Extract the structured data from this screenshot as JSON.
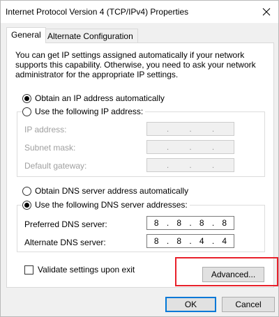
{
  "window": {
    "title": "Internet Protocol Version 4 (TCP/IPv4) Properties"
  },
  "tabs": [
    {
      "label": "General",
      "active": true
    },
    {
      "label": "Alternate Configuration",
      "active": false
    }
  ],
  "general": {
    "intro": "You can get IP settings assigned automatically if your network supports this capability. Otherwise, you need to ask your network administrator for the appropriate IP settings.",
    "ip_auto_label": "Obtain an IP address automatically",
    "ip_manual_label": "Use the following IP address:",
    "ip_fields": [
      {
        "label": "IP address:",
        "octets": [
          "",
          "",
          "",
          ""
        ]
      },
      {
        "label": "Subnet mask:",
        "octets": [
          "",
          "",
          "",
          ""
        ]
      },
      {
        "label": "Default gateway:",
        "octets": [
          "",
          "",
          "",
          ""
        ]
      }
    ],
    "dns_auto_label": "Obtain DNS server address automatically",
    "dns_manual_label": "Use the following DNS server addresses:",
    "dns_fields": [
      {
        "label": "Preferred DNS server:",
        "octets": [
          "8",
          "8",
          "8",
          "8"
        ]
      },
      {
        "label": "Alternate DNS server:",
        "octets": [
          "8",
          "8",
          "4",
          "4"
        ]
      }
    ],
    "validate_label": "Validate settings upon exit",
    "advanced_label": "Advanced..."
  },
  "footer": {
    "ok_label": "OK",
    "cancel_label": "Cancel"
  },
  "state": {
    "ip_mode": "auto",
    "dns_mode": "manual",
    "validate_checked": false
  },
  "colors": {
    "highlight": "#e8202a",
    "default_button_border": "#0078d7"
  },
  "icons": {
    "close": "close-icon"
  }
}
